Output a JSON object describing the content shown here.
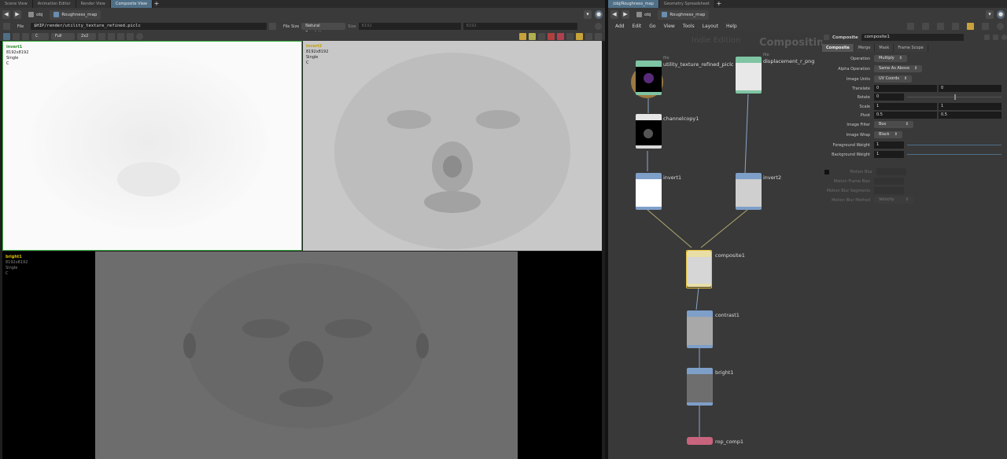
{
  "left_tabs": [
    "Scene View",
    "Animation Editor",
    "Render View",
    "Composite View"
  ],
  "left_active_tab": 3,
  "right_tabs": [
    "/obj/Roughness_map",
    "Geometry Spreadsheet"
  ],
  "right_active_tab": 0,
  "path": {
    "root": "obj",
    "node": "Roughness_map"
  },
  "comp_toolbar": {
    "file_label": "File",
    "file_path": "$HIP/render/utility_texture_refined.piclc",
    "file_size_label": "File Size",
    "file_size_value": "Natural Resolution",
    "size_label": "Size",
    "size_x": "8192",
    "size_y": "8192"
  },
  "view_toolbar": {
    "plane": "C",
    "res": "Full",
    "layout": "2x2"
  },
  "viewports": [
    {
      "name": "invert1",
      "res": "8192x8192",
      "depth": "Single",
      "plane": "C",
      "name_color": "#2a8f2a"
    },
    {
      "name": "invert2",
      "res": "8192x8192",
      "depth": "Single",
      "plane": "C",
      "name_color": "#c8a000"
    },
    {
      "name": "bright1",
      "res": "8192x8192",
      "depth": "Single",
      "plane": "C",
      "name_color": "#e0c000"
    }
  ],
  "menu": [
    "Add",
    "Edit",
    "Go",
    "View",
    "Tools",
    "Layout",
    "Help"
  ],
  "network": {
    "watermark_small": "Indie Edition",
    "watermark_big": "Compositing",
    "nodes": [
      {
        "name": "utility_texture_refined_piclc",
        "sub": "file"
      },
      {
        "name": "displacement_r_png",
        "sub": "file"
      },
      {
        "name": "channelcopy1"
      },
      {
        "name": "invert1"
      },
      {
        "name": "invert2"
      },
      {
        "name": "composite1"
      },
      {
        "name": "contrast1"
      },
      {
        "name": "bright1"
      },
      {
        "name": "rop_comp1"
      }
    ]
  },
  "params": {
    "type": "Composite",
    "node_name": "composite1",
    "tabs": [
      "Composite",
      "Merge",
      "Mask",
      "Frame Scope"
    ],
    "active_tab": 0,
    "rows": {
      "operation": {
        "label": "Operation",
        "value": "Multiply"
      },
      "alpha_operation": {
        "label": "Alpha Operation",
        "value": "Same As Above"
      },
      "image_units": {
        "label": "Image Units",
        "value": "UV Coords"
      },
      "translate": {
        "label": "Translate",
        "x": "0",
        "y": "0"
      },
      "rotate": {
        "label": "Rotate",
        "value": "0"
      },
      "scale": {
        "label": "Scale",
        "x": "1",
        "y": "1"
      },
      "pivot": {
        "label": "Pivot",
        "x": "0.5",
        "y": "0.5"
      },
      "image_filter": {
        "label": "Image Filter",
        "value": "Box"
      },
      "image_wrap": {
        "label": "Image Wrap",
        "value": "Black"
      },
      "fg_weight": {
        "label": "Foreground Weight",
        "value": "1"
      },
      "bg_weight": {
        "label": "Background Weight",
        "value": "1"
      },
      "motion_blur": {
        "label": "Motion Blur"
      },
      "motion_frame_bias": {
        "label": "Motion Frame Bias"
      },
      "motion_blur_segments": {
        "label": "Motion Blur Segments"
      },
      "motion_blur_method": {
        "label": "Motion Blur Method",
        "value": "Velocity"
      }
    }
  },
  "colors": {
    "accent": "#4f6f87",
    "file_node": "#7fc4a3",
    "composite_node": "#e9dfa6",
    "filter_node": "#7e9fc8",
    "rop_node": "#c8647e",
    "selected": "#e8c23a"
  }
}
